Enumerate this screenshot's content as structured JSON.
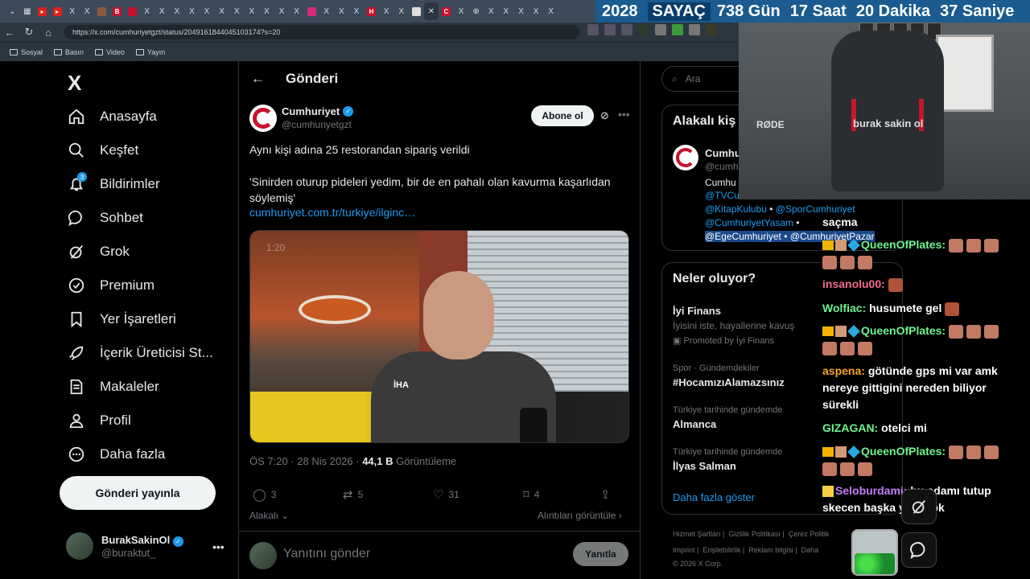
{
  "browser": {
    "url": "https://x.com/cumhuriyetgzt/status/2049161844045103174?s=20",
    "bookmarks": [
      "Sosyal",
      "Basın",
      "Video",
      "Yayın"
    ]
  },
  "counter": {
    "year": "2028",
    "label": "SAYAÇ",
    "days": "738 Gün",
    "hours": "17 Saat",
    "minutes": "20 Dakika",
    "seconds": "37 Saniye"
  },
  "nav": {
    "logo": "X",
    "items": [
      {
        "label": "Anasayfa",
        "icon": "home-icon"
      },
      {
        "label": "Keşfet",
        "icon": "search-icon"
      },
      {
        "label": "Bildirimler",
        "icon": "bell-icon"
      },
      {
        "label": "Sohbet",
        "icon": "chat-icon"
      },
      {
        "label": "Grok",
        "icon": "grok-icon"
      },
      {
        "label": "Premium",
        "icon": "premium-icon"
      },
      {
        "label": "Yer İşaretleri",
        "icon": "bookmark-icon"
      },
      {
        "label": "İçerik Üreticisi St...",
        "icon": "rocket-icon"
      },
      {
        "label": "Makaleler",
        "icon": "article-icon"
      },
      {
        "label": "Profil",
        "icon": "person-icon"
      },
      {
        "label": "Daha fazla",
        "icon": "more-circle-icon"
      }
    ],
    "notification_count": "3",
    "post_button": "Gönderi yayınla",
    "user": {
      "name": "BurakSakinOl",
      "handle": "@buraktut_"
    }
  },
  "post": {
    "header": "Gönderi",
    "author": {
      "name": "Cumhuriyet",
      "handle": "@cumhuriyetgzt"
    },
    "subscribe": "Abone ol",
    "text_line1": "Aynı kişi adına 25 restorandan sipariş verildi",
    "text_line2": "'Sinirden oturup pideleri yedim, bir de en pahalı olan kavurma kaşarlıdan söylemiş'",
    "link": "cumhuriyet.com.tr/turkiye/ilginc…",
    "video_time": "1:20",
    "video_watermark": "İHA",
    "time": "ÖS 7:20 · 28 Nis 2026 · ",
    "views": "44,1 B",
    "views_label": " Görüntüleme",
    "actions": {
      "replies": "3",
      "reposts": "5",
      "likes": "31",
      "bookmarks": "4"
    },
    "related": "Alakalı",
    "quotes": "Alıntıları görüntüle",
    "reply_placeholder": "Yanıtını gönder",
    "reply_button": "Yanıtla"
  },
  "sidebar": {
    "search_placeholder": "Ara",
    "relevant_title": "Alakalı kiş",
    "relevant": {
      "name": "Cumhu",
      "handle": "@cumh",
      "bio": "Cumhu",
      "mentions": [
        "@TVCu",
        "@KitapKulubu",
        "@SporCumhuriyet",
        "@CumhuriyetYasam",
        "@EgeCumhuriyet",
        "@CumhuriyetPazar"
      ]
    },
    "trends_title": "Neler oluyor?",
    "trends": [
      {
        "title": "İyi Finans",
        "desc": "İyisini iste, hayallerine kavuş",
        "meta": "Promoted by İyi Finans"
      },
      {
        "meta": "Spor · Gündemdekiler",
        "title": "#HocamızıAlamazsınız"
      },
      {
        "meta": "Türkiye tarihinde gündemde",
        "title": "Almanca"
      },
      {
        "meta": "Türkiye tarihinde gündemde",
        "title": "İlyas Salman"
      }
    ],
    "show_more": "Daha fazla göster",
    "footer_row1": [
      "Hizmet Şartları",
      "Gizlilik Politikası",
      "Çerez Politik"
    ],
    "footer_row2": [
      "Imprint",
      "Erişilebilirlik",
      "Reklam bilgisi",
      "Daha"
    ],
    "copyright": "© 2026 X Corp."
  },
  "webcam": {
    "mic_brand": "RØDE",
    "chair_brand": "burak sakin ol"
  },
  "chat": [
    {
      "user": "",
      "text": "saçma"
    },
    {
      "user": "QueenOfPlates:",
      "text": ""
    },
    {
      "user": "insanolu00:",
      "text": ""
    },
    {
      "user": "Wolfiac:",
      "text": "husumete gel"
    },
    {
      "user": "QueenOfPlates:",
      "text": ""
    },
    {
      "user": "aspena:",
      "text": "götünde gps mi var amk nereye gittigini nereden biliyor sürekli"
    },
    {
      "user": "GIZAGAN:",
      "text": "otelci mi"
    },
    {
      "user": "QueenOfPlates:",
      "text": ""
    },
    {
      "user": "Seloburdami:",
      "text": "bu adamı tutup skecen başka yolu yok"
    }
  ],
  "colors": {
    "accent": "#1d9bf0",
    "counter_bg": "#1b5b8f",
    "brand_red": "#c8102e"
  }
}
